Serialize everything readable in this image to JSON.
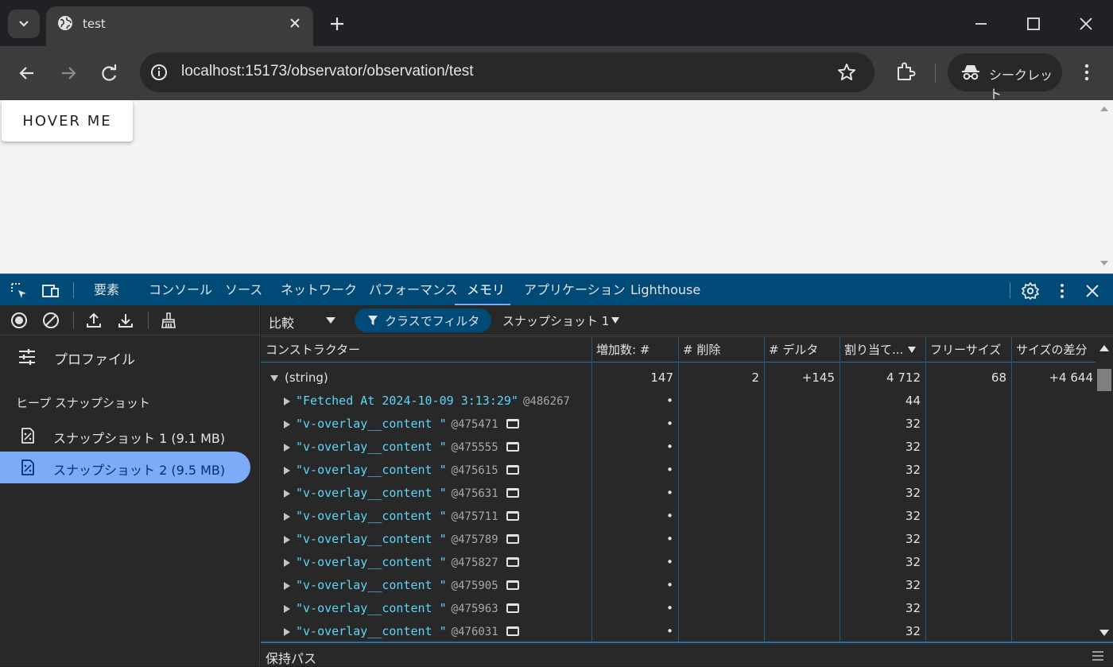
{
  "browser": {
    "tab_title": "test",
    "url": "localhost:15173/observator/observation/test",
    "profile_label": "シークレット"
  },
  "page": {
    "hover_button_label": "HOVER ME"
  },
  "devtools": {
    "tabs": [
      "要素",
      "コンソール",
      "ソース",
      "ネットワーク",
      "パフォーマンス",
      "メモリ",
      "アプリケーション",
      "Lighthouse"
    ],
    "active_tab": "メモリ",
    "sidebar": {
      "profiles_label": "プロファイル",
      "heap_heading": "ヒープ スナップショット",
      "snapshots": [
        {
          "label": "スナップショット 1 (9.1 MB)",
          "selected": false
        },
        {
          "label": "スナップショット 2 (9.5 MB)",
          "selected": true
        }
      ]
    },
    "toolbar": {
      "view_mode": "比較",
      "class_filter_label": "クラスでフィルタ",
      "base_snapshot": "スナップショット 1"
    },
    "columns": [
      "コンストラクター",
      "増加数: #",
      "# 削除",
      "# デルタ",
      "割り当て...",
      "フリーサイズ",
      "サイズの差分"
    ],
    "group": {
      "name": "(string)",
      "new": "147",
      "deleted": "2",
      "delta": "+145",
      "alloc": "4 712",
      "freed": "68",
      "size_delta": "+4 644"
    },
    "rows": [
      {
        "value": "\"Fetched At 2024-10-09 3:13:29\"",
        "id": "@486267",
        "window_icon": false,
        "new": "•",
        "alloc": "44"
      },
      {
        "value": "\"v-overlay__content \"",
        "id": "@475471",
        "window_icon": true,
        "new": "•",
        "alloc": "32"
      },
      {
        "value": "\"v-overlay__content \"",
        "id": "@475555",
        "window_icon": true,
        "new": "•",
        "alloc": "32"
      },
      {
        "value": "\"v-overlay__content \"",
        "id": "@475615",
        "window_icon": true,
        "new": "•",
        "alloc": "32"
      },
      {
        "value": "\"v-overlay__content \"",
        "id": "@475631",
        "window_icon": true,
        "new": "•",
        "alloc": "32"
      },
      {
        "value": "\"v-overlay__content \"",
        "id": "@475711",
        "window_icon": true,
        "new": "•",
        "alloc": "32"
      },
      {
        "value": "\"v-overlay__content \"",
        "id": "@475789",
        "window_icon": true,
        "new": "•",
        "alloc": "32"
      },
      {
        "value": "\"v-overlay__content \"",
        "id": "@475827",
        "window_icon": true,
        "new": "•",
        "alloc": "32"
      },
      {
        "value": "\"v-overlay__content \"",
        "id": "@475905",
        "window_icon": true,
        "new": "•",
        "alloc": "32"
      },
      {
        "value": "\"v-overlay__content \"",
        "id": "@475963",
        "window_icon": true,
        "new": "•",
        "alloc": "32"
      },
      {
        "value": "\"v-overlay__content \"",
        "id": "@476031",
        "window_icon": true,
        "new": "•",
        "alloc": "32"
      }
    ],
    "retainers_label": "保持パス"
  },
  "colors": {
    "devtools_tabbar": "#004a77",
    "selected_snapshot": "#7cacf8",
    "string_value": "#5cd5fb"
  }
}
